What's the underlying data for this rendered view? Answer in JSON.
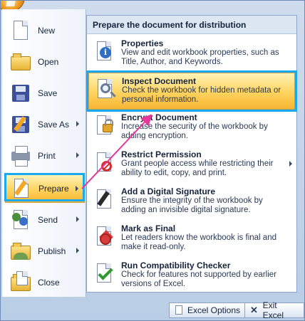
{
  "left_menu": {
    "items": [
      {
        "label": "New",
        "icon": "new-document-icon",
        "has_arrow": false
      },
      {
        "label": "Open",
        "icon": "open-folder-icon",
        "has_arrow": false
      },
      {
        "label": "Save",
        "icon": "save-floppy-icon",
        "has_arrow": false
      },
      {
        "label": "Save As",
        "icon": "save-as-icon",
        "has_arrow": true
      },
      {
        "label": "Print",
        "icon": "printer-icon",
        "has_arrow": true
      },
      {
        "label": "Prepare",
        "icon": "prepare-icon",
        "has_arrow": true,
        "selected": true
      },
      {
        "label": "Send",
        "icon": "send-icon",
        "has_arrow": true
      },
      {
        "label": "Publish",
        "icon": "publish-icon",
        "has_arrow": true
      },
      {
        "label": "Close",
        "icon": "close-document-icon",
        "has_arrow": false
      }
    ]
  },
  "submenu": {
    "header": "Prepare the document for distribution",
    "items": [
      {
        "title": "Properties",
        "desc": "View and edit workbook properties, such as Title, Author, and Keywords.",
        "icon": "properties-icon"
      },
      {
        "title": "Inspect Document",
        "desc": "Check the workbook for hidden metadata or personal information.",
        "icon": "inspect-document-icon",
        "selected": true
      },
      {
        "title": "Encrypt Document",
        "desc": "Increase the security of the workbook by adding encryption.",
        "icon": "encrypt-lock-icon"
      },
      {
        "title": "Restrict Permission",
        "desc": "Grant people access while restricting their ability to edit, copy, and print.",
        "icon": "restrict-permission-icon",
        "has_arrow": true
      },
      {
        "title": "Add a Digital Signature",
        "desc": "Ensure the integrity of the workbook by adding an invisible digital signature.",
        "icon": "digital-signature-icon"
      },
      {
        "title": "Mark as Final",
        "desc": "Let readers know the workbook is final and make it read-only.",
        "icon": "mark-as-final-icon"
      },
      {
        "title": "Run Compatibility Checker",
        "desc": "Check for features not supported by earlier versions of Excel.",
        "icon": "compatibility-check-icon"
      }
    ]
  },
  "footer": {
    "excel_options": "Excel Options",
    "exit_excel": "Exit Excel"
  },
  "colors": {
    "highlight": "#1aa9ee",
    "selection": "#ffd35e",
    "annotation_arrow": "#e6379a"
  }
}
